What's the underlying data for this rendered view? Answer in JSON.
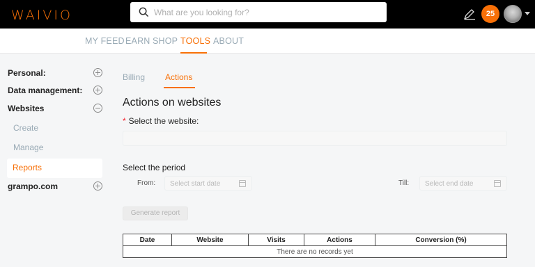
{
  "header": {
    "logo": "WAIVIO",
    "search_placeholder": "What are you looking for?",
    "badge_count": "25"
  },
  "nav": {
    "items": [
      "MY FEED",
      "EARN",
      "SHOP",
      "TOOLS",
      "ABOUT"
    ],
    "active": "TOOLS"
  },
  "sidebar": {
    "personal": "Personal:",
    "data_management": "Data management:",
    "websites": "Websites",
    "create": "Create",
    "manage": "Manage",
    "reports": "Reports",
    "grampo": "grampo.com"
  },
  "content": {
    "tabs": [
      "Billing",
      "Actions"
    ],
    "active_tab": "Actions",
    "title": "Actions on websites",
    "select_website_label": "Select the website:",
    "period_label": "Select the period",
    "from_label": "From:",
    "till_label": "Till:",
    "start_placeholder": "Select start date",
    "end_placeholder": "Select end date",
    "generate_button": "Generate report",
    "table_headers": [
      "Date",
      "Website",
      "Visits",
      "Actions",
      "Conversion (%)"
    ],
    "empty_text": "There are no records yet"
  }
}
